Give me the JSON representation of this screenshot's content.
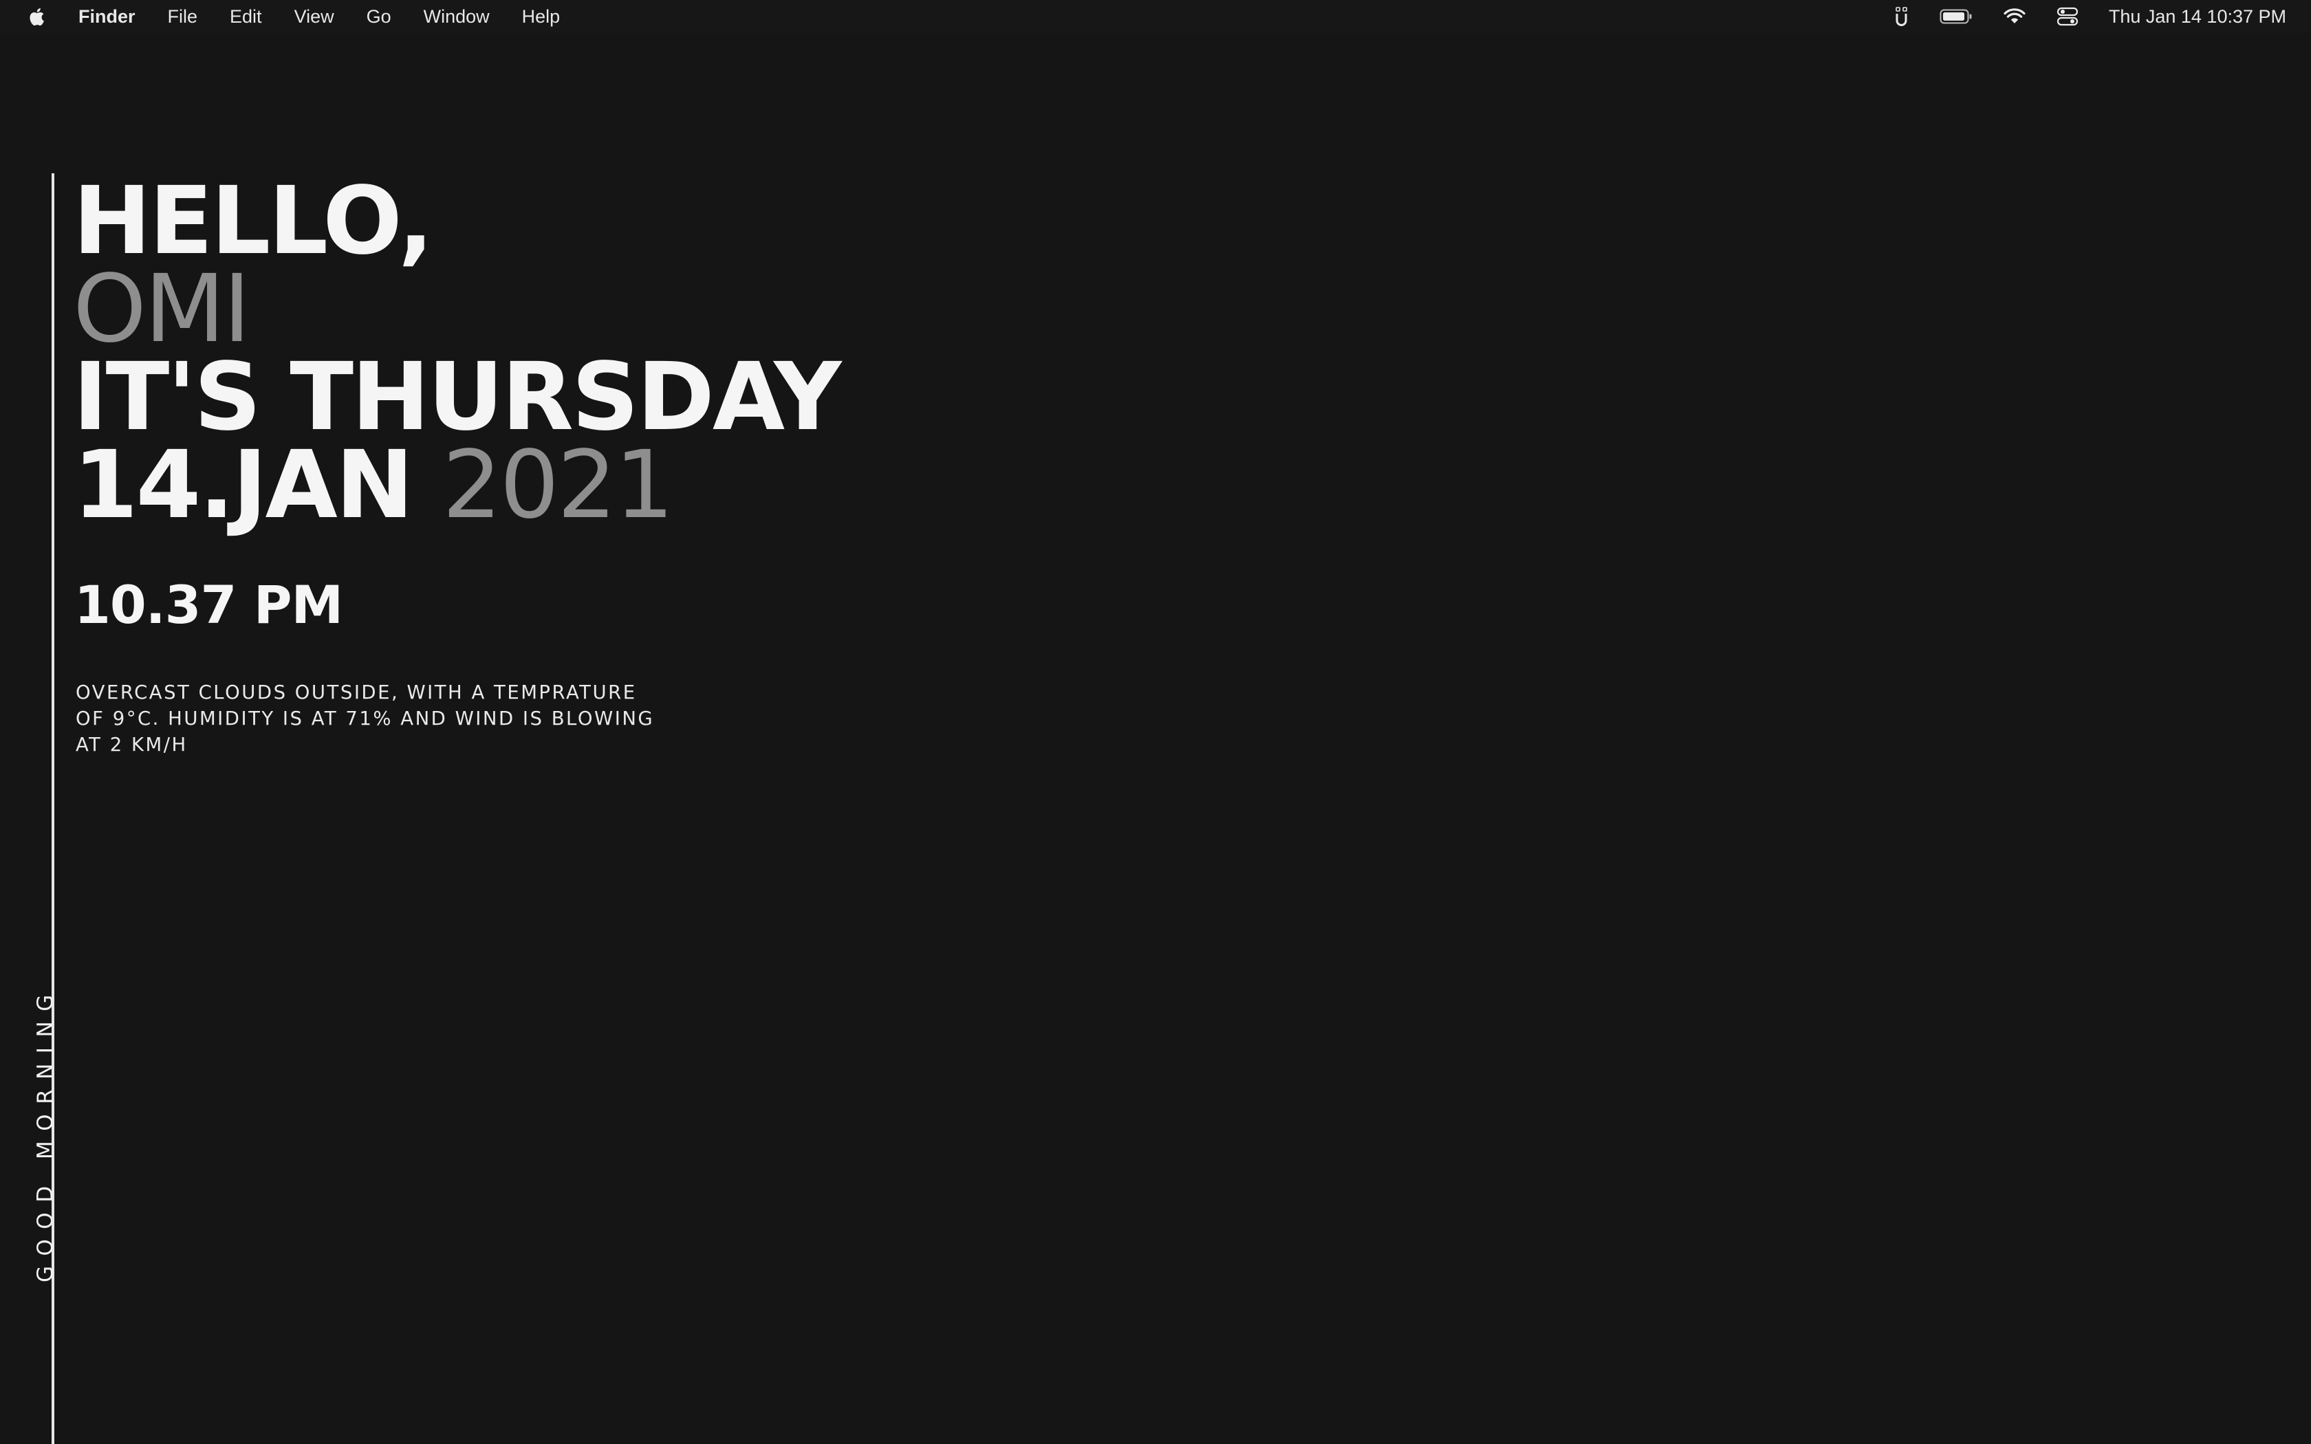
{
  "menubar": {
    "app_name": "Finder",
    "items": [
      "File",
      "Edit",
      "View",
      "Go",
      "Window",
      "Help"
    ],
    "clock": "Thu Jan 14  10:37 PM",
    "status_icons": [
      "ubersicht-icon",
      "battery-icon",
      "wifi-icon",
      "control-center-icon"
    ]
  },
  "widget": {
    "greeting_line": "HELLO,",
    "name": "OMI",
    "day_line": "IT'S THURSDAY",
    "date_main": "14.JAN",
    "date_year": "2021",
    "time": "10.37 PM",
    "weather": "OVERCAST CLOUDS OUTSIDE, WITH A TEMPRATURE OF 9°C. HUMIDITY IS AT 71% AND WIND IS BLOWING AT 2 KM/H",
    "side_greeting": "GOOD MORNING"
  },
  "colors": {
    "background": "#151515",
    "menubar": "#171717",
    "primary_text": "#f5f5f5",
    "muted_text": "#8e8e8e"
  }
}
